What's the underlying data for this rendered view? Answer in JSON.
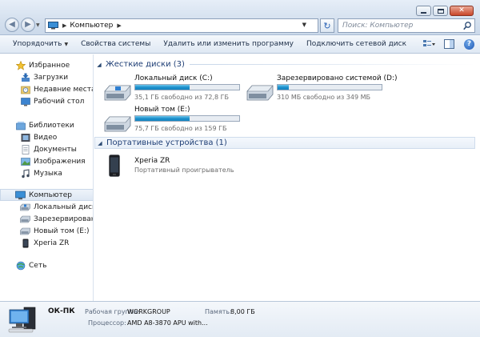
{
  "window": {
    "minimize_icon": "minimize-icon",
    "maximize_icon": "maximize-icon",
    "close_icon": "close-icon"
  },
  "address": {
    "path": "Компьютер",
    "icon": "computer-icon"
  },
  "search": {
    "placeholder": "Поиск: Компьютер"
  },
  "toolbar": {
    "organize": "Упорядочить",
    "system_properties": "Свойства системы",
    "uninstall": "Удалить или изменить программу",
    "map_drive": "Подключить сетевой диск"
  },
  "sidebar": {
    "favorites": "Избранное",
    "downloads": "Загрузки",
    "recent": "Недавние места",
    "desktop": "Рабочий стол",
    "libraries": "Библиотеки",
    "video": "Видео",
    "documents": "Документы",
    "images": "Изображения",
    "music": "Музыка",
    "computer": "Компьютер",
    "drive_c": "Локальный диск (C",
    "reserved": "Зарезервировано с",
    "new_volume": "Новый том (E:)",
    "xperia": "Xperia ZR",
    "network": "Сеть"
  },
  "groups": {
    "hard_disks": "Жесткие диски (3)",
    "portable": "Портативные устройства (1)"
  },
  "drives": [
    {
      "name": "Локальный диск (C:)",
      "free": "35,1 ГБ свободно из 72,8 ГБ",
      "used_fraction": 0.52
    },
    {
      "name": "Зарезервировано системой (D:)",
      "free": "310 МБ свободно из 349 МБ",
      "used_fraction": 0.11
    },
    {
      "name": "Новый том (E:)",
      "free": "75,7 ГБ свободно из 159 ГБ",
      "used_fraction": 0.52
    }
  ],
  "device": {
    "name": "Xperia ZR",
    "description": "Портативный проигрыватель"
  },
  "details": {
    "pc_name": "ОК-ПК",
    "workgroup_label": "Рабочая группа:",
    "workgroup_value": "WORKGROUP",
    "memory_label": "Память:",
    "memory_value": "8,00 ГБ",
    "cpu_label": "Процессор:",
    "cpu_value": "AMD A8-3870 APU with..."
  }
}
